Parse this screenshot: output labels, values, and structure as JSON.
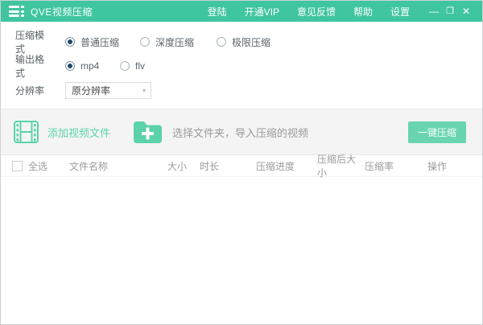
{
  "window": {
    "title": "QVE视频压缩",
    "nav": [
      {
        "label": "登陆"
      },
      {
        "label": "开通VIP"
      },
      {
        "label": "意见反馈"
      },
      {
        "label": "帮助"
      },
      {
        "label": "设置"
      }
    ],
    "controls": {
      "minimize": "—",
      "maximize": "❐",
      "close": "✕"
    }
  },
  "settings": {
    "compression_mode": {
      "label": "压缩模式",
      "options": [
        {
          "label": "普通压缩",
          "selected": true
        },
        {
          "label": "深度压缩",
          "selected": false
        },
        {
          "label": "极限压缩",
          "selected": false
        }
      ]
    },
    "output_format": {
      "label": "输出格式",
      "options": [
        {
          "label": "mp4",
          "selected": true
        },
        {
          "label": "flv",
          "selected": false
        }
      ]
    },
    "resolution": {
      "label": "分辨率",
      "value": "原分辨率",
      "arrow": "▾"
    }
  },
  "import_bar": {
    "add_files_label": "添加视频文件",
    "folder_hint": "选择文件夹，导入压缩的视频",
    "compress_button": "一键压缩"
  },
  "table": {
    "select_all_label": "全选",
    "columns": {
      "name": "文件名称",
      "size": "大小",
      "duration": "时长",
      "progress": "压缩进度",
      "after_size": "压缩后大小",
      "ratio": "压缩率",
      "action": "操作"
    },
    "rows": []
  },
  "colors": {
    "titlebar": "#3fc5a0",
    "accent_green": "#5bd2aa",
    "button_green": "#69d5b0",
    "band_gray": "#f4f4f4",
    "radio_selected_dot": "#1f4a6e",
    "header_text": "#9b9b9b"
  }
}
